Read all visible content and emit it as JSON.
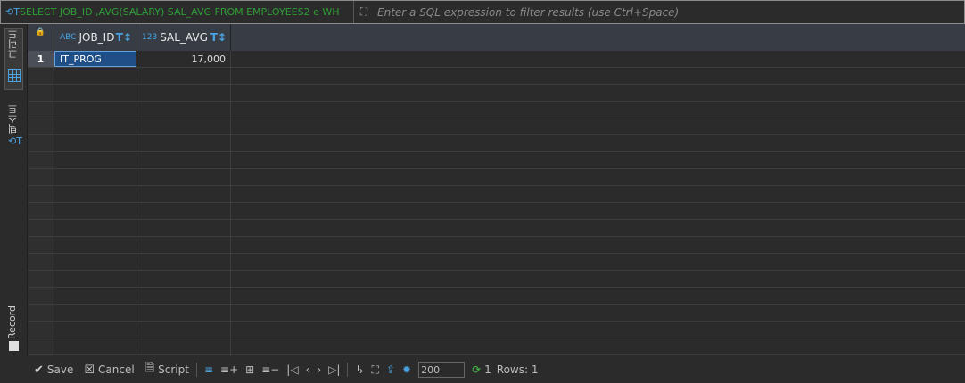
{
  "filter": {
    "sql_text": "SELECT JOB_ID ,AVG(SALARY) SAL_AVG FROM EMPLOYEES2 e WH",
    "placeholder": "Enter a SQL expression to filter results (use Ctrl+Space)"
  },
  "side_tabs": {
    "grid": "그리드",
    "text": "텍스트",
    "record": "Record"
  },
  "columns": [
    {
      "type_tag": "ABC",
      "name": "JOB_ID"
    },
    {
      "type_tag": "123",
      "name": "SAL_AVG"
    }
  ],
  "rows": [
    {
      "num": "1",
      "job_id": "IT_PROG",
      "sal_avg": "17,000"
    }
  ],
  "bottom": {
    "save": "Save",
    "cancel": "Cancel",
    "script": "Script",
    "fetch_size": "200",
    "refresh_count": "1",
    "rows_label": "Rows: 1"
  },
  "colors": {
    "accent": "#4aa3e0",
    "selection": "#1f4f86",
    "sql_green": "#2f9e35"
  }
}
